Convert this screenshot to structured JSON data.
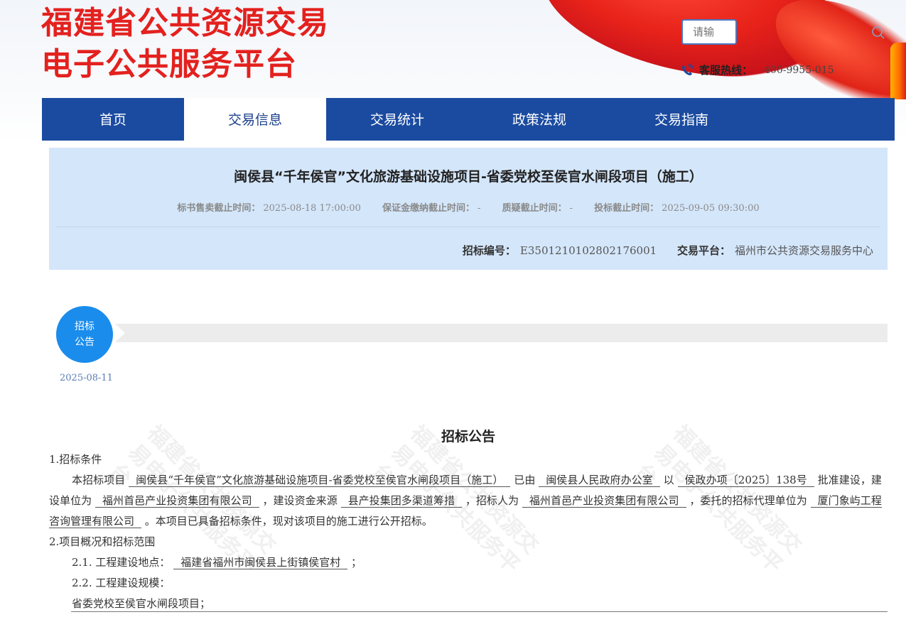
{
  "header": {
    "title_line1": "福建省公共资源交易",
    "title_line2": "电子公共服务平台",
    "search_placeholder": "请输",
    "hotline_label": "客服热线：",
    "hotline_number": "400-9955-015"
  },
  "nav": {
    "items": [
      {
        "label": "首页"
      },
      {
        "label": "交易信息"
      },
      {
        "label": "交易统计"
      },
      {
        "label": "政策法规"
      },
      {
        "label": "交易指南"
      }
    ],
    "active_index": 1
  },
  "project": {
    "title": "闽侯县“千年侯官”文化旅游基础设施项目-省委党校至侯官水闸段项目（施工）",
    "deadlines": [
      {
        "label": "标书售卖截止时间：",
        "value": "2025-08-18 17:00:00"
      },
      {
        "label": "保证金缴纳截止时间：",
        "value": "-"
      },
      {
        "label": "质疑截止时间：",
        "value": "-"
      },
      {
        "label": "投标截止时间：",
        "value": "2025-09-05 09:30:00"
      }
    ],
    "code_label": "招标编号：",
    "code_value": "E3501210102802176001",
    "platform_label": "交易平台：",
    "platform_value": "福州市公共资源交易服务中心"
  },
  "timeline": {
    "step_label": "招标公告",
    "date": "2025-08-11"
  },
  "watermark_text": "福建省公共资源交易电子公共服务平台",
  "notice": {
    "heading": "招标公告",
    "sec1_title": "1.招标条件",
    "p1_a": "本招标项目",
    "p1_project": "闽侯县“千年侯官”文化旅游基础设施项目-省委党校至侯官水闸段项目（施工）",
    "p1_b": "已由",
    "p1_approver": "闽侯县人民政府办公室",
    "p1_c": "以",
    "p1_doc": "侯政办项〔2025〕138号",
    "p1_d": "批准建设，建设单位为",
    "p1_owner": "福州首邑产业投资集团有限公司",
    "p1_e": "，建设资金来源",
    "p1_fund": "县产投集团多渠道筹措",
    "p1_f": "，招标人为",
    "p1_tenderer": "福州首邑产业投资集团有限公司",
    "p1_g": "，委托的招标代理单位为",
    "p1_agent": "厦门象屿工程咨询管理有限公司",
    "p1_h": "。本项目已具备招标条件，现对该项目的施工进行公开招标。",
    "sec2_title": "2.项目概况和招标范围",
    "s21_label": "2.1.  工程建设地点：",
    "s21_value": "福建省福州市闽侯县上街镇侯官村",
    "s21_end": "；",
    "s22_label": "2.2.  工程建设规模：",
    "s22_body": "省委党校至侯官水闸段项目；"
  },
  "colors": {
    "nav_bg": "#1b4ba0",
    "brand_red": "#e3211e",
    "panel_bg": "#d4e6fa",
    "timeline_blue": "#1a8cec"
  }
}
